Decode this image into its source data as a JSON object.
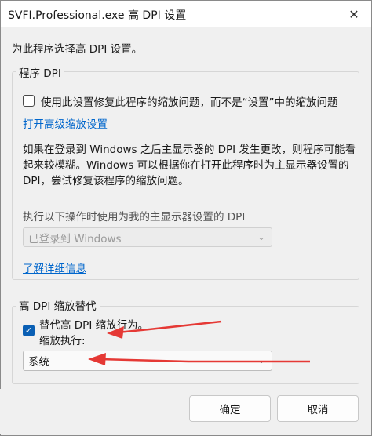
{
  "window": {
    "title": "SVFI.Professional.exe 高 DPI 设置",
    "close_glyph": "✕"
  },
  "intro": "为此程序选择高 DPI 设置。",
  "program_dpi": {
    "legend": "程序 DPI",
    "checkbox_label": "使用此设置修复此程序的缩放问题，而不是“设置”中的缩放问题",
    "checkbox_checked": false,
    "advanced_link": "打开高级缩放设置",
    "description": "如果在登录到 Windows 之后主显示器的 DPI 发生更改，则程序可能看起来较模糊。Windows 可以根据你在打开此程序时为主显示器设置的 DPI，尝试修复该程序的缩放问题。",
    "select_label": "执行以下操作时使用为我的主显示器设置的 DPI",
    "select_value": "已登录到 Windows",
    "learn_more_link": "了解详细信息"
  },
  "override": {
    "legend": "高 DPI 缩放替代",
    "checkbox_label": "替代高 DPI 缩放行为。",
    "checkbox_checked": true,
    "scaling_label": "缩放执行:",
    "select_value": "系统"
  },
  "buttons": {
    "ok": "确定",
    "cancel": "取消"
  },
  "icons": {
    "checkmark": "✓",
    "chevron": "⌄"
  },
  "colors": {
    "accent": "#0a5fb4",
    "link": "#0066cc",
    "annotation_arrow": "#e53935"
  }
}
